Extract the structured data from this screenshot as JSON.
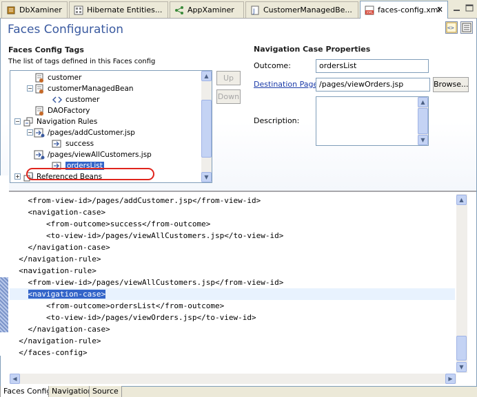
{
  "tabs": [
    {
      "label": "DbXaminer",
      "icon": "dbxaminer-icon"
    },
    {
      "label": "Hibernate Entities...",
      "icon": "hibernate-icon"
    },
    {
      "label": "AppXaminer",
      "icon": "appxaminer-icon"
    },
    {
      "label": "CustomerManagedBe...",
      "icon": "java-file-icon"
    },
    {
      "label": "faces-config.xml",
      "icon": "xml-file-icon",
      "active": true
    }
  ],
  "header": {
    "title": "Faces Configuration"
  },
  "left": {
    "title": "Faces Config Tags",
    "description": "The list of tags defined in this Faces config",
    "up_label": "Up",
    "down_label": "Down",
    "tree": [
      {
        "label": "customer"
      },
      {
        "label": "customerManagedBean"
      },
      {
        "label": "customer"
      },
      {
        "label": "DAOFactory"
      },
      {
        "label": "Navigation Rules"
      },
      {
        "label": "/pages/addCustomer.jsp"
      },
      {
        "label": "success"
      },
      {
        "label": "/pages/viewAllCustomers.jsp"
      },
      {
        "label": "ordersList"
      },
      {
        "label": "Referenced Beans"
      }
    ]
  },
  "right": {
    "title": "Navigation Case Properties",
    "outcome_label": "Outcome:",
    "outcome_value": "ordersList",
    "destination_label": "Destination Page:",
    "destination_value": "/pages/viewOrders.jsp",
    "browse_label": "Browse...",
    "description_label": "Description:",
    "description_value": ""
  },
  "source": {
    "lines": [
      "    <from-view-id>/pages/addCustomer.jsp</from-view-id>",
      "    <navigation-case>",
      "        <from-outcome>success</from-outcome>",
      "        <to-view-id>/pages/viewAllCustomers.jsp</to-view-id>",
      "    </navigation-case>",
      "  </navigation-rule>",
      "  <navigation-rule>",
      "    <from-view-id>/pages/viewAllCustomers.jsp</from-view-id>",
      "    ",
      "        <from-outcome>ordersList</from-outcome>",
      "        <to-view-id>/pages/viewOrders.jsp</to-view-id>",
      "    </navigation-case>",
      "  </navigation-rule>",
      "  </faces-config>"
    ],
    "highlight_indent": "    ",
    "highlight_selected": "<navigation-case>"
  },
  "bottom_tabs": [
    {
      "label": "Faces Config",
      "active": true
    },
    {
      "label": "Navigation"
    },
    {
      "label": "Source"
    }
  ],
  "colors": {
    "title": "#3a5aa0",
    "selection": "#3365c9",
    "annotation_circle": "#e0241c"
  }
}
